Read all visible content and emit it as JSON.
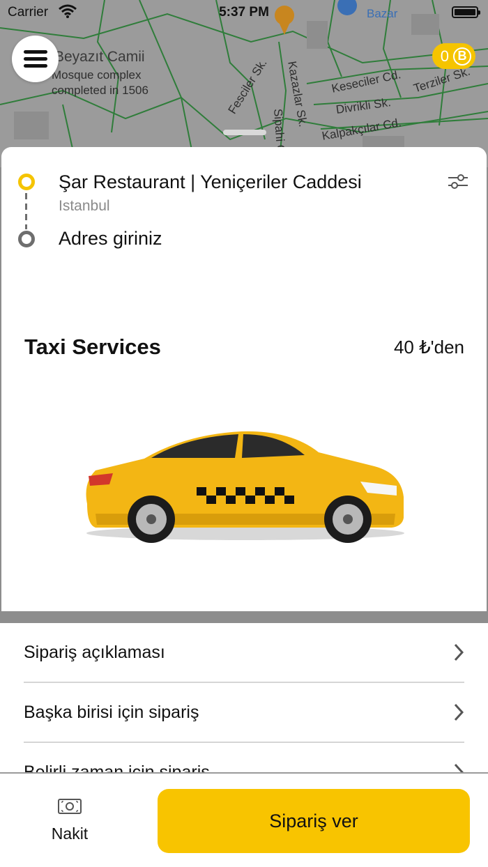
{
  "status_bar": {
    "carrier": "Carrier",
    "time": "5:37 PM"
  },
  "map": {
    "labels": {
      "place_title": "Beyazıt Camii",
      "place_line1": "Mosque complex",
      "place_line2": "completed in 1506",
      "poi": "Bazar",
      "street1": "Fesciler Sk.",
      "street2": "Kazazlar Sk.",
      "street3": "Keseciler Cd.",
      "street4": "Divrikli Sk.",
      "street5": "Terziler Sk.",
      "street6": "Kalpakçılar Cd.",
      "street7": "Sipahi Cd."
    }
  },
  "header": {
    "coin_count": "0",
    "coin_symbol": "B"
  },
  "route": {
    "from_title": "Şar Restaurant | Yeniçeriler Caddesi",
    "from_city": "Istanbul",
    "to_placeholder": "Adres giriniz"
  },
  "service": {
    "title": "Taxi Services",
    "price": "40 ₺'den"
  },
  "options": [
    {
      "label": "Sipariş açıklaması"
    },
    {
      "label": "Başka birisi için sipariş"
    },
    {
      "label": "Belirli zaman için sipariş"
    }
  ],
  "bottom": {
    "payment_label": "Nakit",
    "order_button": "Sipariş ver"
  },
  "colors": {
    "accent": "#f8c400",
    "map": "#9b9b9b",
    "route_green": "#2f7d3a"
  }
}
